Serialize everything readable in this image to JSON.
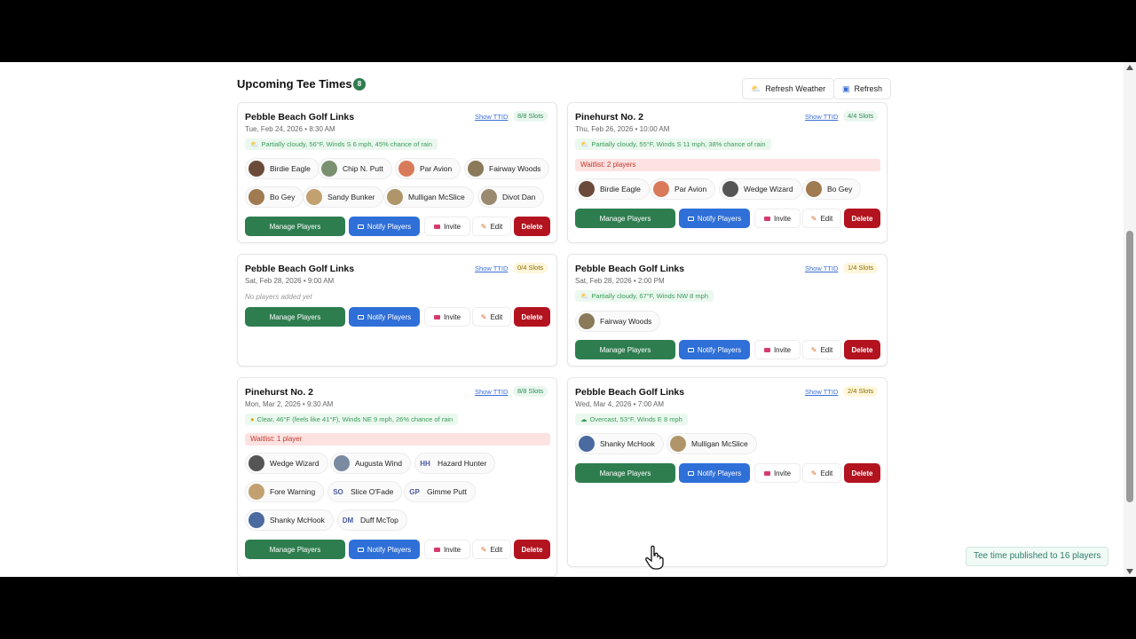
{
  "header": {
    "title": "Upcoming Tee Times",
    "count": "8",
    "refresh_weather_label": "Refresh Weather",
    "refresh_label": "Refresh"
  },
  "common": {
    "show_ttid": "Show TTID",
    "manage_players": "Manage Players",
    "notify_players": "Notify Players",
    "invite": "Invite",
    "edit": "Edit",
    "delete": "Delete",
    "no_players": "No players added yet"
  },
  "cards": [
    {
      "course": "Pebble Beach Golf Links",
      "date": "Tue, Feb 24, 2026 • 8:30 AM",
      "slots": "8/8 Slots",
      "weather": "Partially cloudy, 56°F, Winds S 6 mph, 45% chance of rain",
      "players": [
        "Birdie Eagle",
        "Chip N. Putt",
        "Par Avion",
        "Fairway Woods",
        "Bo Gey",
        "Sandy Bunker",
        "Mulligan McSlice",
        "Divot Dan"
      ]
    },
    {
      "course": "Pinehurst No. 2",
      "date": "Thu, Feb 26, 2026 • 10:00 AM",
      "slots": "4/4 Slots",
      "weather": "Partially cloudy, 55°F, Winds S 11 mph, 38% chance of rain",
      "waitlist": "Waitlist: 2 players",
      "players": [
        "Birdie Eagle",
        "Par Avion",
        "Wedge Wizard",
        "Bo Gey"
      ]
    },
    {
      "course": "Pebble Beach Golf Links",
      "date": "Sat, Feb 28, 2026 • 9:00 AM",
      "slots": "0/4 Slots"
    },
    {
      "course": "Pebble Beach Golf Links",
      "date": "Sat, Feb 28, 2026 • 2:00 PM",
      "slots": "1/4 Slots",
      "weather": "Partially cloudy, 67°F, Winds NW 8 mph",
      "players": [
        "Fairway Woods"
      ]
    },
    {
      "course": "Pinehurst No. 2",
      "date": "Mon, Mar 2, 2026 • 9:30 AM",
      "slots": "8/8 Slots",
      "weather": "Clear, 46°F (feels like 41°F), Winds NE 9 mph, 26% chance of rain",
      "waitlist": "Waitlist: 1 player",
      "players": [
        "Wedge Wizard",
        "Augusta Wind",
        "Hazard Hunter",
        "Fore Warning",
        "Slice O'Fade",
        "Gimme Putt",
        "Shanky McHook",
        "Duff McTop"
      ],
      "initials": {
        "Hazard Hunter": "HH",
        "Slice O'Fade": "SO",
        "Gimme Putt": "GP",
        "Duff McTop": "DM"
      }
    },
    {
      "course": "Pebble Beach Golf Links",
      "date": "Wed, Mar 4, 2026 • 7:00 AM",
      "slots": "2/4 Slots",
      "weather": "Overcast, 53°F, Winds E 8 mph",
      "players": [
        "Shanky McHook",
        "Mulligan McSlice"
      ]
    }
  ],
  "toast": "Tee time published to 16 players",
  "colors": {
    "accent_green": "#2e7d4f",
    "notify_blue": "#2f6fd8",
    "delete_red": "#b3131f"
  }
}
